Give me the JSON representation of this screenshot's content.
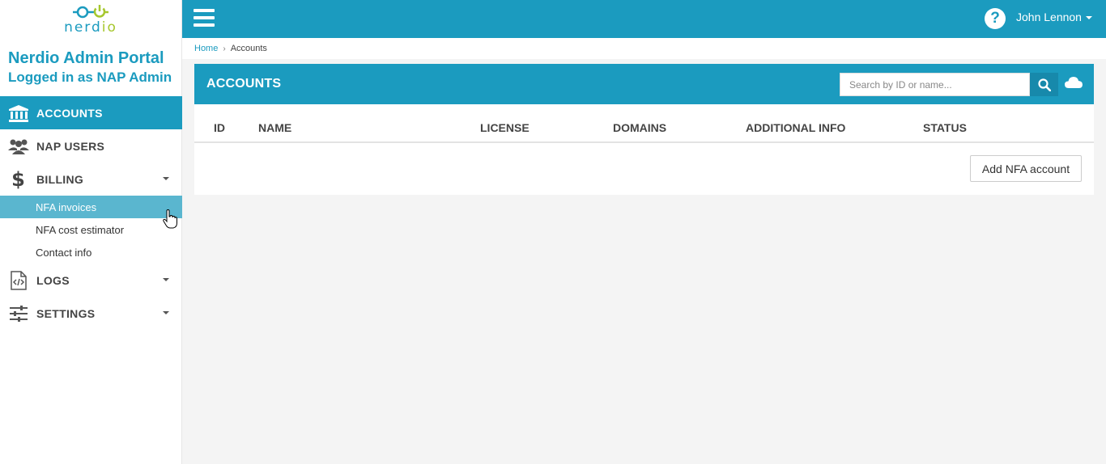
{
  "logo": {
    "text_part1": "nerd",
    "text_part2": "io"
  },
  "portal": {
    "title": "Nerdio Admin Portal",
    "subtitle": "Logged in as NAP Admin"
  },
  "nav": {
    "items": [
      {
        "label": "ACCOUNTS",
        "icon": "bank-icon",
        "active": true
      },
      {
        "label": "NAP USERS",
        "icon": "users-icon"
      },
      {
        "label": "BILLING",
        "icon": "dollar-icon",
        "expanded": true
      },
      {
        "label": "LOGS",
        "icon": "code-file-icon"
      },
      {
        "label": "SETTINGS",
        "icon": "sliders-icon"
      }
    ],
    "billing_sub": [
      {
        "label": "NFA invoices"
      },
      {
        "label": "NFA cost estimator"
      },
      {
        "label": "Contact info"
      }
    ]
  },
  "topbar": {
    "user_name": "John Lennon",
    "help_symbol": "?"
  },
  "breadcrumb": {
    "home": "Home",
    "separator": "›",
    "current": "Accounts"
  },
  "panel": {
    "title": "ACCOUNTS",
    "search_placeholder": "Search by ID or name...",
    "search_value": "",
    "columns": [
      "ID",
      "NAME",
      "LICENSE",
      "DOMAINS",
      "ADDITIONAL INFO",
      "STATUS"
    ],
    "rows": [],
    "add_button": "Add NFA account"
  },
  "colors": {
    "accent": "#1b9bbf",
    "logo_green": "#a6c72d",
    "hover": "#5ab6cf",
    "background": "#f4f4f4"
  }
}
